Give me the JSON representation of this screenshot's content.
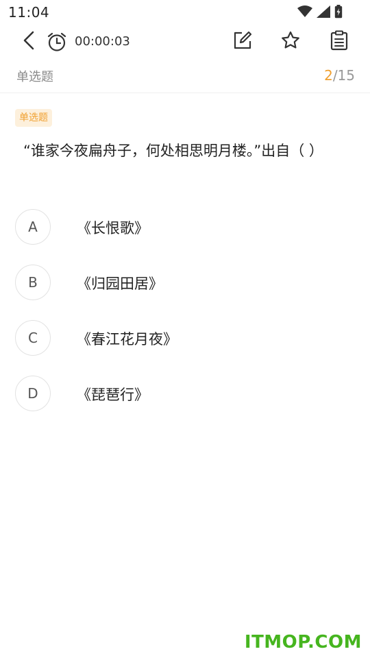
{
  "status_bar": {
    "time": "11:04",
    "icons": [
      "wifi-icon",
      "signal-icon",
      "battery-charging-icon"
    ]
  },
  "toolbar": {
    "timer": "00:00:03",
    "icons": [
      "back-chevron-icon",
      "alarm-clock-icon",
      "edit-note-icon",
      "star-outline-icon",
      "answer-sheet-icon"
    ]
  },
  "header": {
    "type_label": "单选题",
    "progress_current": "2",
    "progress_total": "/15"
  },
  "question": {
    "tag": "单选题",
    "text": "“谁家今夜扁舟子，何处相思明月楼。”出自（ ）",
    "options": [
      {
        "letter": "A",
        "text": "《长恨歌》"
      },
      {
        "letter": "B",
        "text": "《归园田居》"
      },
      {
        "letter": "C",
        "text": "《春江花月夜》"
      },
      {
        "letter": "D",
        "text": "《琵琶行》"
      }
    ]
  },
  "watermark": "ITMOP.COM",
  "colors": {
    "accent": "#f0a030",
    "tag_bg": "#fdf0dc",
    "watermark": "#46b51f"
  }
}
